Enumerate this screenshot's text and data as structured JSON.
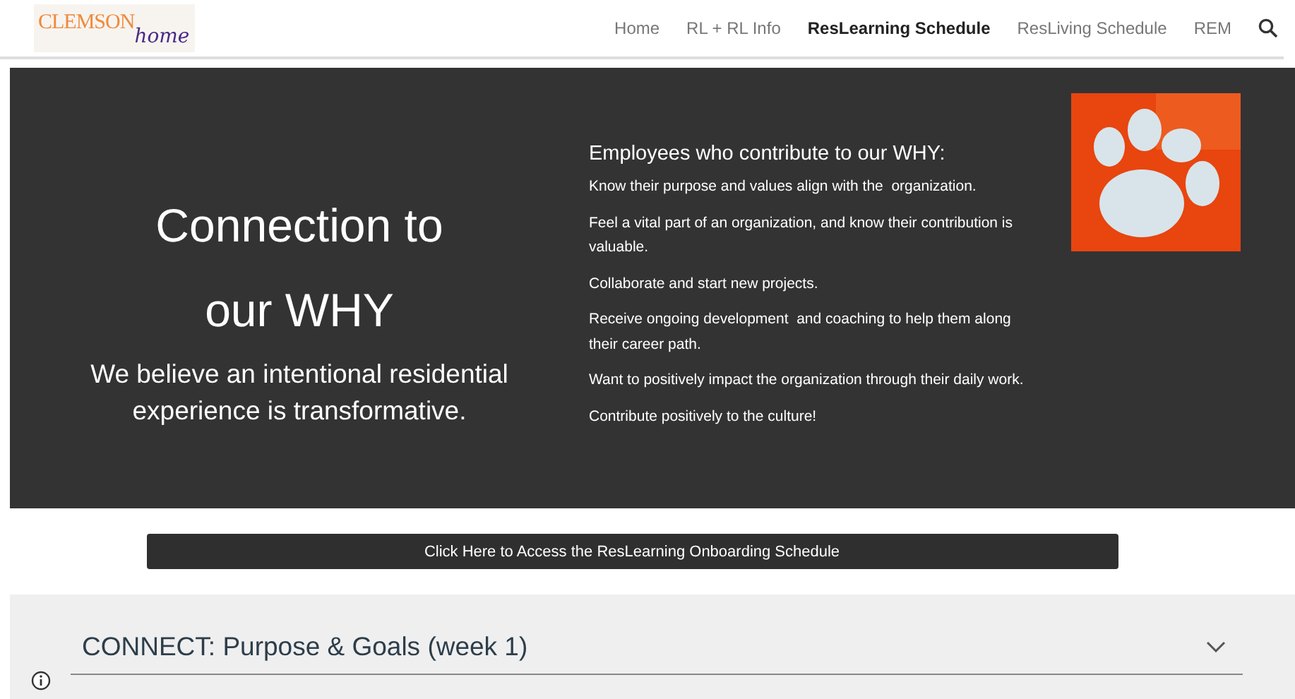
{
  "logo": {
    "word": "CLEMSON",
    "script": "home"
  },
  "nav": [
    {
      "label": "Home",
      "selected": false
    },
    {
      "label": "RL + RL Info",
      "selected": false
    },
    {
      "label": "ResLearning Schedule",
      "selected": true
    },
    {
      "label": "ResLiving Schedule",
      "selected": false
    },
    {
      "label": "REM",
      "selected": false
    }
  ],
  "hero": {
    "title_lines": [
      "Connection to",
      "our WHY"
    ],
    "subtitle": "We believe an intentional residential experience is transformative.",
    "list_heading": "Employees who contribute to our WHY:",
    "list_items": [
      "Know their purpose and values align with the  organization.",
      "Feel a vital part of an organization, and know their contribution is valuable.",
      "Collaborate and start new projects.",
      "Receive ongoing development  and coaching to help them along their career path.",
      "Want to positively impact the organization through their daily work.",
      "Contribute positively to the culture!"
    ]
  },
  "cta_button": "Click Here to Access the ResLearning Onboarding Schedule",
  "accordion": [
    {
      "title": "CONNECT: Purpose & Goals (week 1)",
      "expanded": false
    }
  ]
}
